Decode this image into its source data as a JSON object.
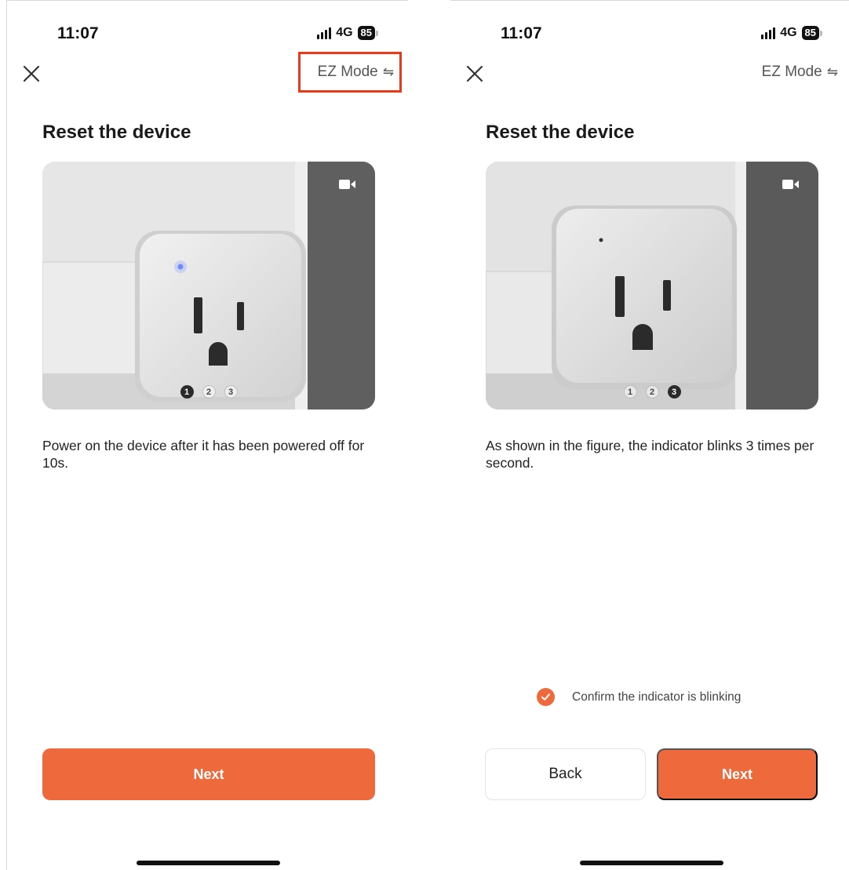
{
  "screens": [
    {
      "status": {
        "time": "11:07",
        "network": "4G",
        "battery": "85"
      },
      "header": {
        "mode_label": "EZ Mode",
        "mode_icon": "swap-arrows-icon",
        "close_icon": "close-icon"
      },
      "title": "Reset the device",
      "image": {
        "pager": [
          "1",
          "2",
          "3"
        ],
        "active_step": 1,
        "indicator_color": "#6f8cff"
      },
      "description": "Power on the device after it has been powered off for 10s.",
      "buttons": {
        "next": "Next"
      }
    },
    {
      "status": {
        "time": "11:07",
        "network": "4G",
        "battery": "85"
      },
      "header": {
        "mode_label": "EZ Mode",
        "mode_icon": "swap-arrows-icon",
        "close_icon": "close-icon"
      },
      "title": "Reset the device",
      "image": {
        "pager": [
          "1",
          "2",
          "3"
        ],
        "active_step": 3
      },
      "description": "As shown in the figure, the indicator blinks 3 times per second.",
      "confirm": {
        "label": "Confirm the indicator is blinking",
        "checked": true
      },
      "buttons": {
        "back": "Back",
        "next": "Next"
      }
    }
  ],
  "colors": {
    "accent": "#ee6a3c",
    "highlight": "#ea3a1a"
  }
}
